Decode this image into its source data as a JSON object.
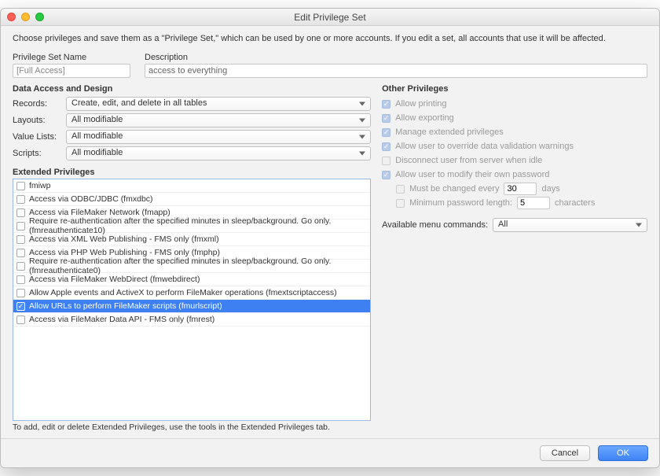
{
  "window_title": "Edit Privilege Set",
  "intro": "Choose privileges and save them as a \"Privilege Set,\" which can be used by one or more accounts. If you edit a set, all accounts that use it will be affected.",
  "name_label": "Privilege Set Name",
  "desc_label": "Description",
  "name_value": "[Full Access]",
  "desc_value": "access to everything",
  "data_access_title": "Data Access and Design",
  "records_label": "Records:",
  "records_popup": "Create, edit, and delete in all tables",
  "layouts_label": "Layouts:",
  "layouts_popup": "All modifiable",
  "valuelists_label": "Value Lists:",
  "valuelists_popup": "All modifiable",
  "scripts_label": "Scripts:",
  "scripts_popup": "All modifiable",
  "ext_title": "Extended Privileges",
  "ext": [
    {
      "chk": false,
      "label": "fmiwp"
    },
    {
      "chk": false,
      "label": "Access via ODBC/JDBC (fmxdbc)"
    },
    {
      "chk": false,
      "label": "Access via FileMaker Network (fmapp)"
    },
    {
      "chk": false,
      "label": "Require re-authentication after the specified minutes in sleep/background.  Go only. (fmreauthenticate10)"
    },
    {
      "chk": false,
      "label": "Access via XML Web Publishing - FMS only (fmxml)"
    },
    {
      "chk": false,
      "label": "Access via PHP Web Publishing - FMS only (fmphp)"
    },
    {
      "chk": false,
      "label": "Require re-authentication after the specified minutes in sleep/background.  Go only. (fmreauthenticate0)"
    },
    {
      "chk": false,
      "label": "Access via FileMaker WebDirect (fmwebdirect)"
    },
    {
      "chk": false,
      "label": "Allow Apple events and ActiveX to perform FileMaker operations (fmextscriptaccess)"
    },
    {
      "chk": true,
      "label": "Allow URLs to perform FileMaker scripts (fmurlscript)",
      "selected": true
    },
    {
      "chk": false,
      "label": "Access via FileMaker Data API - FMS only (fmrest)"
    }
  ],
  "ext_hint": "To add, edit or delete Extended Privileges, use the tools in the Extended Privileges tab.",
  "other_title": "Other Privileges",
  "other": {
    "allow_printing": "Allow printing",
    "allow_exporting": "Allow exporting",
    "manage_ext": "Manage extended privileges",
    "override_validation": "Allow user to override data validation warnings",
    "disconnect_idle": "Disconnect user from server when idle",
    "modify_pw": "Allow user to modify their own password",
    "must_change_label": "Must be changed every",
    "must_change_value": "30",
    "days_label": "days",
    "min_pw_label": "Minimum password length:",
    "min_pw_value": "5",
    "chars_label": "characters"
  },
  "menu_label": "Available menu commands:",
  "menu_popup": "All",
  "cancel": "Cancel",
  "ok": "OK"
}
